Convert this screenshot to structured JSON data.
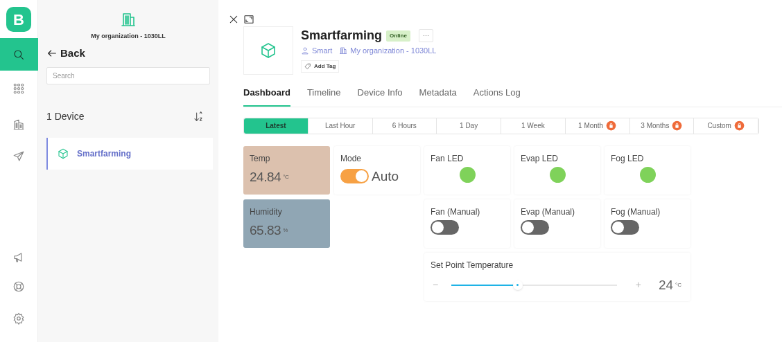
{
  "rail": {
    "logo": "B",
    "items": [
      {
        "selected": true
      },
      {
        "selected": false
      },
      {
        "selected": false
      },
      {
        "selected": false
      },
      {
        "selected": false
      },
      {
        "selected": false
      },
      {
        "selected": false
      }
    ]
  },
  "sidebar": {
    "organization": "My organization - 1030LL",
    "back": "Back",
    "search": {
      "placeholder": "Search"
    },
    "count": "1 Device",
    "devices": [
      {
        "name": "Smartfarming",
        "selected": true
      }
    ]
  },
  "device": {
    "name": "Smartfarming",
    "status": "Online",
    "more": "···",
    "owner": "Smart",
    "organization": "My organization - 1030LL",
    "add_tag": "Add Tag"
  },
  "tabs": [
    {
      "label": "Dashboard",
      "selected": true
    },
    {
      "label": "Timeline",
      "selected": false
    },
    {
      "label": "Device Info",
      "selected": false
    },
    {
      "label": "Metadata",
      "selected": false
    },
    {
      "label": "Actions Log",
      "selected": false
    }
  ],
  "ranges": [
    {
      "label": "Latest",
      "selected": true,
      "locked": false
    },
    {
      "label": "Last Hour",
      "selected": false,
      "locked": false
    },
    {
      "label": "6 Hours",
      "selected": false,
      "locked": false
    },
    {
      "label": "1 Day",
      "selected": false,
      "locked": false
    },
    {
      "label": "1 Week",
      "selected": false,
      "locked": false
    },
    {
      "label": "1 Month",
      "selected": false,
      "locked": true
    },
    {
      "label": "3 Months",
      "selected": false,
      "locked": true
    },
    {
      "label": "Custom",
      "selected": false,
      "locked": true
    }
  ],
  "widgets": [
    {
      "kind": "value",
      "title": "Temp",
      "value": "24.84",
      "unit": "°C",
      "color": "#dcc1ae"
    },
    {
      "kind": "switch",
      "title": "Mode",
      "on": true,
      "label": "Auto"
    },
    {
      "kind": "led",
      "title": "Fan LED",
      "on": true
    },
    {
      "kind": "led",
      "title": "Evap LED",
      "on": true
    },
    {
      "kind": "led",
      "title": "Fog LED",
      "on": true
    },
    {
      "kind": "value",
      "title": "Humidity",
      "value": "65.83",
      "unit": "%",
      "color": "#90a6b4"
    },
    {
      "kind": "switch",
      "title": "Fan (Manual)",
      "on": false
    },
    {
      "kind": "switch",
      "title": "Evap (Manual)",
      "on": false
    },
    {
      "kind": "switch",
      "title": "Fog (Manual)",
      "on": false
    },
    {
      "kind": "slider",
      "title": "Set Point Temperature",
      "minus": "−",
      "plus": "+",
      "level": 0.4,
      "value": "24",
      "unit": "°C"
    }
  ]
}
